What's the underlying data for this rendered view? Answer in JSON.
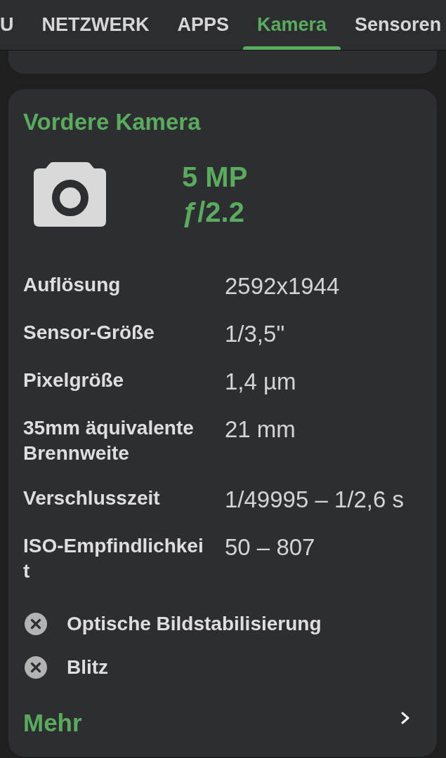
{
  "tabs": [
    {
      "label": "U",
      "selected": false
    },
    {
      "label": "NETZWERK",
      "selected": false
    },
    {
      "label": "APPS",
      "selected": false
    },
    {
      "label": "Kamera",
      "selected": true
    },
    {
      "label": "Sensoren",
      "selected": false
    }
  ],
  "camera_card": {
    "title": "Vordere Kamera",
    "megapixels": "5 MP",
    "aperture": "ƒ/2.2",
    "specs": [
      {
        "label": "Auflösung",
        "value": "2592x1944"
      },
      {
        "label": "Sensor-Größe",
        "value": "1/3,5\""
      },
      {
        "label": "Pixelgröße",
        "value": "1,4 µm"
      },
      {
        "label": "35mm äquivalente Brennweite",
        "value": "21 mm"
      },
      {
        "label": "Verschlusszeit",
        "value": "1/49995 – 1/2,6 s"
      },
      {
        "label": "ISO-Empfindlichkeit",
        "value": "50 – 807"
      }
    ],
    "features": [
      {
        "label": "Optische Bildstabilisierung",
        "supported": false
      },
      {
        "label": "Blitz",
        "supported": false
      }
    ],
    "more_link": "Mehr"
  }
}
